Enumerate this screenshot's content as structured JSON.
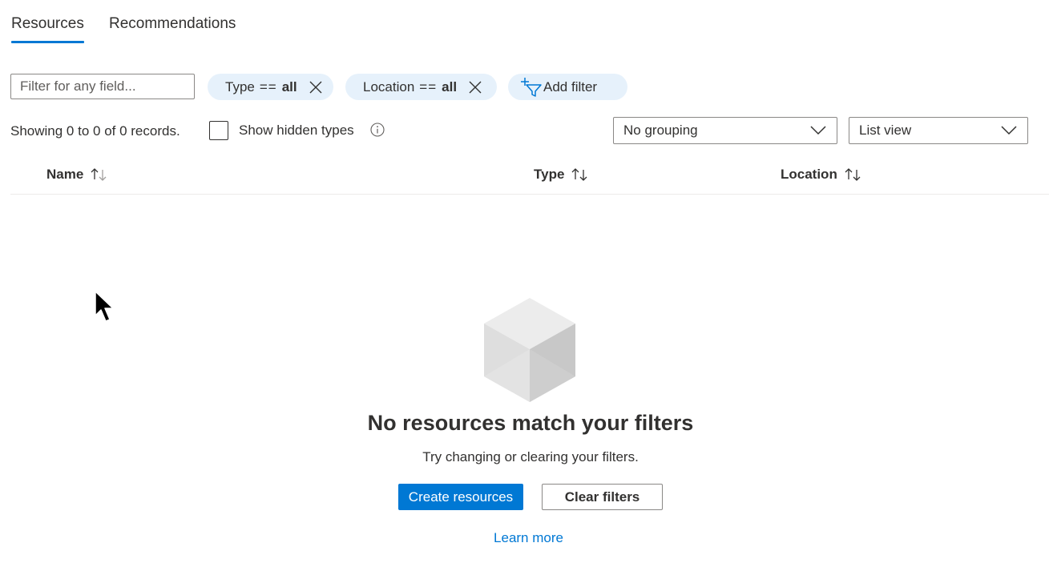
{
  "tabs": [
    {
      "label": "Resources",
      "active": true
    },
    {
      "label": "Recommendations",
      "active": false
    }
  ],
  "filter_bar": {
    "search_placeholder": "Filter for any field...",
    "pills": [
      {
        "field": "Type",
        "operator": "==",
        "value": "all"
      },
      {
        "field": "Location",
        "operator": "==",
        "value": "all"
      }
    ],
    "add_filter_label": "Add filter"
  },
  "toolbar": {
    "records_text": "Showing 0 to 0 of 0 records.",
    "show_hidden_label": "Show hidden types",
    "show_hidden_checked": false,
    "grouping_value": "No grouping",
    "view_value": "List view"
  },
  "table": {
    "columns": [
      "Name",
      "Type",
      "Location"
    ]
  },
  "empty_state": {
    "title": "No resources match your filters",
    "subtitle": "Try changing or clearing your filters.",
    "primary_button": "Create resources",
    "secondary_button": "Clear filters",
    "link": "Learn more"
  },
  "icons": {
    "pill_close": "close-icon",
    "add_filter": "add-filter-icon",
    "info": "info-icon",
    "dropdown": "chevron-down-icon",
    "sort": "sort-arrows-icon",
    "empty": "cube-icon"
  },
  "colors": {
    "accent": "#0078d4",
    "pill_bg": "#e6f1fb",
    "text": "#323130",
    "border": "#8a8886"
  }
}
